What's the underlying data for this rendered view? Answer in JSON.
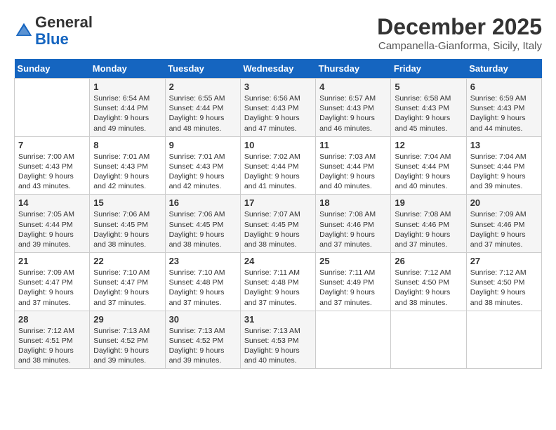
{
  "header": {
    "logo_general": "General",
    "logo_blue": "Blue",
    "month_title": "December 2025",
    "location": "Campanella-Gianforma, Sicily, Italy"
  },
  "weekdays": [
    "Sunday",
    "Monday",
    "Tuesday",
    "Wednesday",
    "Thursday",
    "Friday",
    "Saturday"
  ],
  "weeks": [
    [
      {
        "day": "",
        "info": ""
      },
      {
        "day": "1",
        "info": "Sunrise: 6:54 AM\nSunset: 4:44 PM\nDaylight: 9 hours\nand 49 minutes."
      },
      {
        "day": "2",
        "info": "Sunrise: 6:55 AM\nSunset: 4:44 PM\nDaylight: 9 hours\nand 48 minutes."
      },
      {
        "day": "3",
        "info": "Sunrise: 6:56 AM\nSunset: 4:43 PM\nDaylight: 9 hours\nand 47 minutes."
      },
      {
        "day": "4",
        "info": "Sunrise: 6:57 AM\nSunset: 4:43 PM\nDaylight: 9 hours\nand 46 minutes."
      },
      {
        "day": "5",
        "info": "Sunrise: 6:58 AM\nSunset: 4:43 PM\nDaylight: 9 hours\nand 45 minutes."
      },
      {
        "day": "6",
        "info": "Sunrise: 6:59 AM\nSunset: 4:43 PM\nDaylight: 9 hours\nand 44 minutes."
      }
    ],
    [
      {
        "day": "7",
        "info": "Sunrise: 7:00 AM\nSunset: 4:43 PM\nDaylight: 9 hours\nand 43 minutes."
      },
      {
        "day": "8",
        "info": "Sunrise: 7:01 AM\nSunset: 4:43 PM\nDaylight: 9 hours\nand 42 minutes."
      },
      {
        "day": "9",
        "info": "Sunrise: 7:01 AM\nSunset: 4:43 PM\nDaylight: 9 hours\nand 42 minutes."
      },
      {
        "day": "10",
        "info": "Sunrise: 7:02 AM\nSunset: 4:44 PM\nDaylight: 9 hours\nand 41 minutes."
      },
      {
        "day": "11",
        "info": "Sunrise: 7:03 AM\nSunset: 4:44 PM\nDaylight: 9 hours\nand 40 minutes."
      },
      {
        "day": "12",
        "info": "Sunrise: 7:04 AM\nSunset: 4:44 PM\nDaylight: 9 hours\nand 40 minutes."
      },
      {
        "day": "13",
        "info": "Sunrise: 7:04 AM\nSunset: 4:44 PM\nDaylight: 9 hours\nand 39 minutes."
      }
    ],
    [
      {
        "day": "14",
        "info": "Sunrise: 7:05 AM\nSunset: 4:44 PM\nDaylight: 9 hours\nand 39 minutes."
      },
      {
        "day": "15",
        "info": "Sunrise: 7:06 AM\nSunset: 4:45 PM\nDaylight: 9 hours\nand 38 minutes."
      },
      {
        "day": "16",
        "info": "Sunrise: 7:06 AM\nSunset: 4:45 PM\nDaylight: 9 hours\nand 38 minutes."
      },
      {
        "day": "17",
        "info": "Sunrise: 7:07 AM\nSunset: 4:45 PM\nDaylight: 9 hours\nand 38 minutes."
      },
      {
        "day": "18",
        "info": "Sunrise: 7:08 AM\nSunset: 4:46 PM\nDaylight: 9 hours\nand 37 minutes."
      },
      {
        "day": "19",
        "info": "Sunrise: 7:08 AM\nSunset: 4:46 PM\nDaylight: 9 hours\nand 37 minutes."
      },
      {
        "day": "20",
        "info": "Sunrise: 7:09 AM\nSunset: 4:46 PM\nDaylight: 9 hours\nand 37 minutes."
      }
    ],
    [
      {
        "day": "21",
        "info": "Sunrise: 7:09 AM\nSunset: 4:47 PM\nDaylight: 9 hours\nand 37 minutes."
      },
      {
        "day": "22",
        "info": "Sunrise: 7:10 AM\nSunset: 4:47 PM\nDaylight: 9 hours\nand 37 minutes."
      },
      {
        "day": "23",
        "info": "Sunrise: 7:10 AM\nSunset: 4:48 PM\nDaylight: 9 hours\nand 37 minutes."
      },
      {
        "day": "24",
        "info": "Sunrise: 7:11 AM\nSunset: 4:48 PM\nDaylight: 9 hours\nand 37 minutes."
      },
      {
        "day": "25",
        "info": "Sunrise: 7:11 AM\nSunset: 4:49 PM\nDaylight: 9 hours\nand 37 minutes."
      },
      {
        "day": "26",
        "info": "Sunrise: 7:12 AM\nSunset: 4:50 PM\nDaylight: 9 hours\nand 38 minutes."
      },
      {
        "day": "27",
        "info": "Sunrise: 7:12 AM\nSunset: 4:50 PM\nDaylight: 9 hours\nand 38 minutes."
      }
    ],
    [
      {
        "day": "28",
        "info": "Sunrise: 7:12 AM\nSunset: 4:51 PM\nDaylight: 9 hours\nand 38 minutes."
      },
      {
        "day": "29",
        "info": "Sunrise: 7:13 AM\nSunset: 4:52 PM\nDaylight: 9 hours\nand 39 minutes."
      },
      {
        "day": "30",
        "info": "Sunrise: 7:13 AM\nSunset: 4:52 PM\nDaylight: 9 hours\nand 39 minutes."
      },
      {
        "day": "31",
        "info": "Sunrise: 7:13 AM\nSunset: 4:53 PM\nDaylight: 9 hours\nand 40 minutes."
      },
      {
        "day": "",
        "info": ""
      },
      {
        "day": "",
        "info": ""
      },
      {
        "day": "",
        "info": ""
      }
    ]
  ]
}
